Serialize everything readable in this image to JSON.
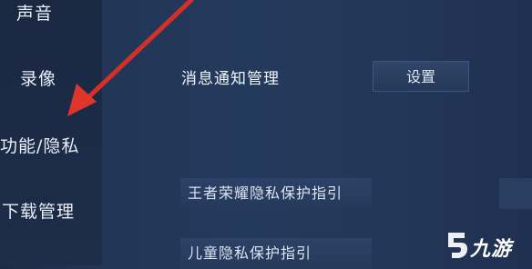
{
  "sidebar": {
    "items": [
      {
        "label": "声音"
      },
      {
        "label": "录像"
      },
      {
        "label": "功能/隐私"
      },
      {
        "label": "下载管理"
      }
    ]
  },
  "main": {
    "notification_label": "消息通知管理",
    "settings_button": "设置",
    "links": [
      {
        "label": "王者荣耀隐私保护指引"
      },
      {
        "label": "儿童隐私保护指引"
      }
    ]
  },
  "watermark": {
    "text": "九游"
  },
  "colors": {
    "arrow": "#e0352b",
    "background": "#223555",
    "text": "#e8eef8"
  }
}
